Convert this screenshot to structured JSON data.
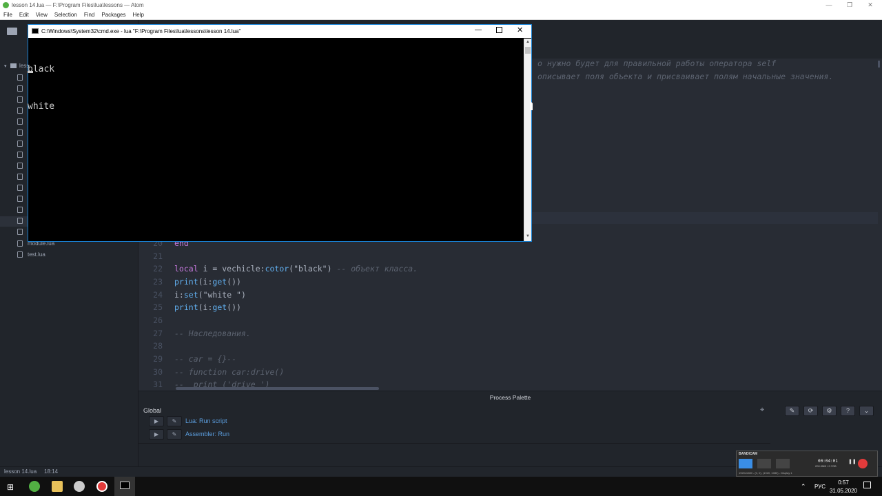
{
  "atom_window": {
    "title": "lesson 14.lua — F:\\Program Files\\lua\\lessons — Atom",
    "menu": [
      "File",
      "Edit",
      "View",
      "Selection",
      "Find",
      "Packages",
      "Help"
    ]
  },
  "tree": {
    "root_label": "less",
    "files": [
      "module.lua",
      "test.lua"
    ]
  },
  "editor": {
    "top_comment_1": "о нужно будет для правильной работы оператора self",
    "top_comment_2": "описывает поля объекта и присваивает полям начальные значения.",
    "lines": [
      {
        "num": "20",
        "text": "end"
      },
      {
        "num": "21",
        "text": ""
      },
      {
        "num": "22",
        "kw": "local",
        "a": " i = vechicle:",
        "fn": "cotor",
        "b": "(",
        "st": "\"black\"",
        "c": ") ",
        "cm": "-- объект класса."
      },
      {
        "num": "23",
        "fn": "print",
        "a": "(i:",
        "fn2": "get",
        "b": "())"
      },
      {
        "num": "24",
        "a": "i:",
        "fn": "set",
        "b": "(",
        "st": "\"white \"",
        "c": ")"
      },
      {
        "num": "25",
        "fn": "print",
        "a": "(i:",
        "fn2": "get",
        "b": "())"
      },
      {
        "num": "26",
        "text": ""
      },
      {
        "num": "27",
        "cm": "-- Наследования."
      },
      {
        "num": "28",
        "text": ""
      },
      {
        "num": "29",
        "cm": "-- car = {}--"
      },
      {
        "num": "30",
        "cm": "-- function car:drive()"
      },
      {
        "num": "31",
        "cm": "--  print ('drive ')"
      }
    ]
  },
  "process_palette": {
    "title": "Process Palette",
    "scope": "Global",
    "commands": [
      "Lua: Run script",
      "Assembler: Run"
    ]
  },
  "status": {
    "file": "lesson 14.lua",
    "position": "18:14"
  },
  "cmd_window": {
    "title": "C:\\Windows\\System32\\cmd.exe - lua  \"F:\\Program Files\\lua\\lessons\\lesson 14.lua\"",
    "output": [
      "black",
      "white"
    ]
  },
  "bandicam": {
    "brand": "BANDICAM",
    "timer": "00:04:01",
    "size": "200.0MB / 2.7GB",
    "info": "1920x1080 - (0, 0), (1920, 1080) - Display 1"
  },
  "taskbar": {
    "lang": "РУС",
    "time": "0:57",
    "date": "31.05.2020"
  },
  "colors": {
    "editor_bg": "#282c34",
    "sidebar_bg": "#21252b",
    "cmd_bg": "#000000",
    "link": "#5c9fe0"
  }
}
